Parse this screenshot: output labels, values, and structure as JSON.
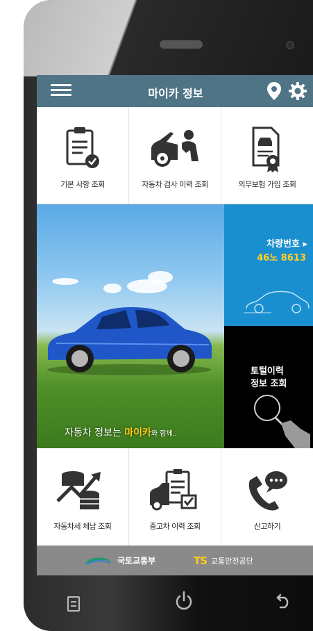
{
  "appbar": {
    "title": "마이카 정보"
  },
  "top_menu": [
    {
      "label": "기본 사항 조회",
      "icon": "clipboard-check-icon"
    },
    {
      "label": "자동차 검사 이력 조회",
      "icon": "car-inspection-icon"
    },
    {
      "label": "의무보험 가입 조회",
      "icon": "insurance-certificate-icon"
    }
  ],
  "banner": {
    "caption_prefix": "자동차 정보는",
    "caption_highlight": "마이카",
    "caption_suffix": "와 함께.."
  },
  "plate_panel": {
    "label": "차량번호 ▸",
    "number": "46노 8613"
  },
  "total_panel": {
    "line1": "토털이력",
    "line2": "정보 조회"
  },
  "bottom_menu": [
    {
      "label": "자동차세 체납 조회",
      "icon": "coins-chart-icon"
    },
    {
      "label": "중고차 이력 조회",
      "icon": "used-car-checklist-icon"
    },
    {
      "label": "신고하기",
      "icon": "phone-chat-icon"
    }
  ],
  "footer": {
    "ministry": "국토교통부",
    "ts_mark": "TS",
    "ts_name": "교통안전공단"
  },
  "colors": {
    "appbar": "#4f7486",
    "plate_panel": "#1a8fd0",
    "plate_number": "#ffd21f",
    "highlight": "#ffcc1a",
    "footer": "#8a8a8a"
  }
}
